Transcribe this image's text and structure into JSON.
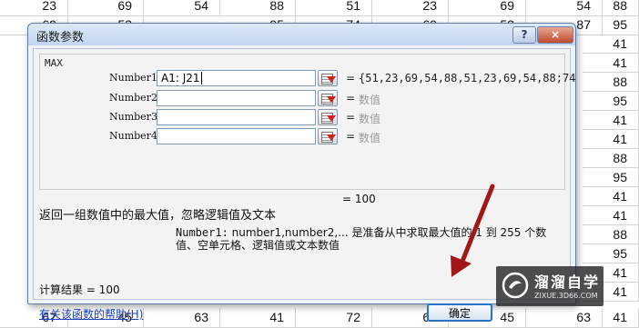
{
  "spreadsheet": {
    "rows": [
      [
        "23",
        "69",
        "54",
        "88",
        "51",
        "23",
        "69",
        "54",
        "88"
      ],
      [
        "69",
        "53",
        "",
        "95",
        "74",
        "69",
        "53",
        "87",
        "95"
      ],
      [],
      [],
      [],
      [],
      [],
      [],
      [],
      [],
      [],
      [],
      [],
      [],
      [],
      [],
      [
        "67",
        "45",
        "63",
        "41",
        "72",
        "67",
        "45",
        "63",
        "41"
      ]
    ],
    "right_column": [
      "88",
      "95",
      "41",
      "41",
      "88",
      "95",
      "41",
      "41",
      "88",
      "95",
      "41",
      "41",
      "88",
      "95",
      "41",
      "41",
      "41"
    ]
  },
  "dialog": {
    "title": "函数参数",
    "help_glyph": "?",
    "close_glyph": "×",
    "function_name": "MAX",
    "args": [
      {
        "label": "Number1",
        "value": "A1: J21",
        "result": "{51,23,69,54,88,51,23,69,54,88;74"
      },
      {
        "label": "Number2",
        "value": "",
        "result": "数值"
      },
      {
        "label": "Number3",
        "value": "",
        "result": "数值"
      },
      {
        "label": "Number4",
        "value": "",
        "result": "数值"
      }
    ],
    "equals": "=",
    "result_line": "=  100",
    "description": "返回一组数值中的最大值，忽略逻辑值及文本",
    "param_name": "Number1:",
    "param_text": "number1,number2,... 是准备从中求取最大值的 1 到 255 个数值、空单元格、逻辑值或文本数值",
    "calc_result": "计算结果 =  100",
    "help_link": "有关该函数的帮助(H)",
    "ok_label": "确定"
  },
  "watermark": {
    "title": "溜溜自学",
    "subtitle": "ZIXUE.3D66.COM"
  },
  "colors": {
    "annotation_arrow": "#a01818",
    "title_bar": "#c3d6ef",
    "link": "#1b3fb6"
  }
}
